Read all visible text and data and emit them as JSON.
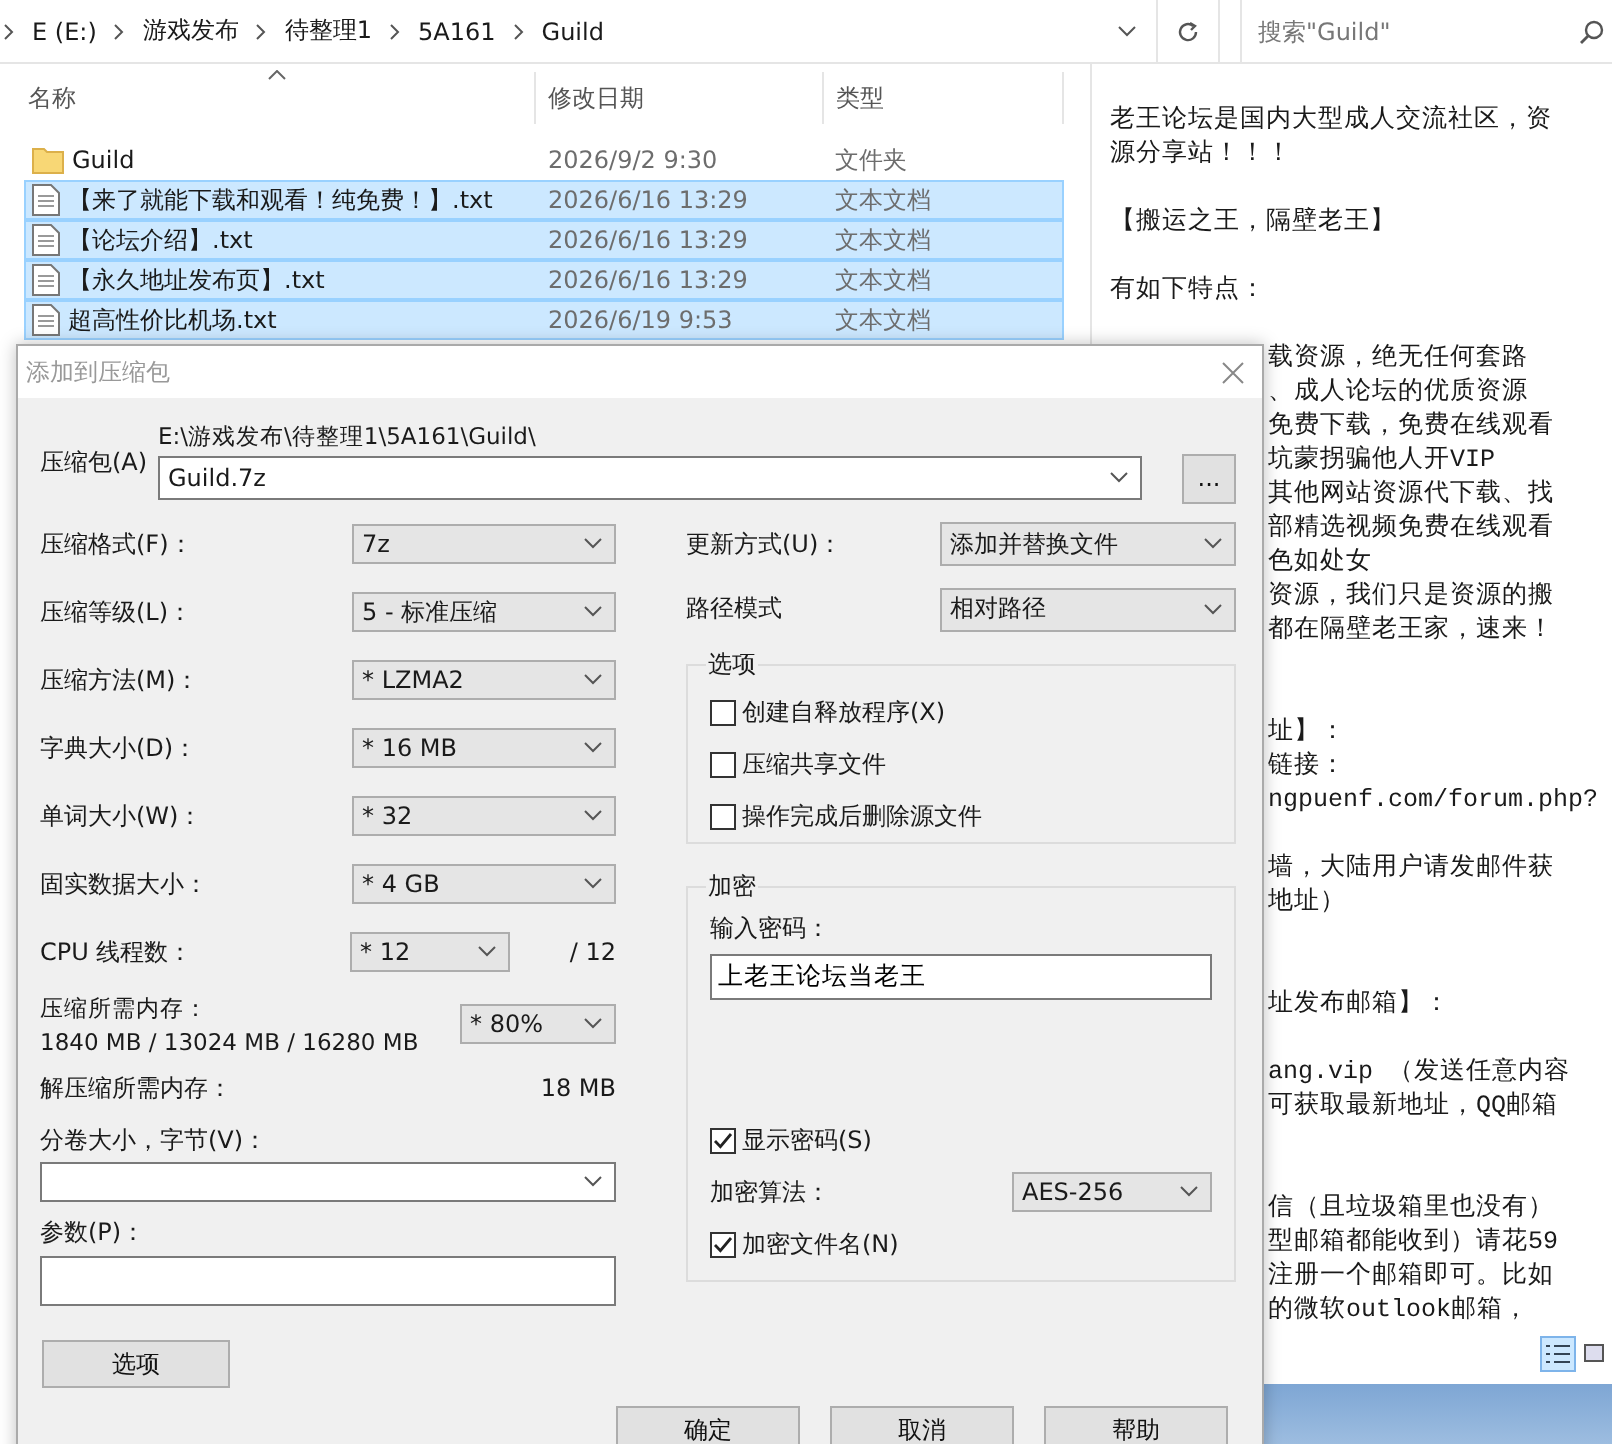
{
  "explorer": {
    "breadcrumb": [
      "E (E:)",
      "游戏发布",
      "待整理1",
      "5A161",
      "Guild"
    ],
    "search": {
      "placeholder": "搜索\"Guild\""
    },
    "columns": [
      "名称",
      "修改日期",
      "类型"
    ],
    "files": [
      {
        "name": "Guild",
        "modified": "2026/9/2 9:30",
        "type": "文件夹",
        "kind": "folder",
        "selected": false
      },
      {
        "name": "【来了就能下载和观看！纯免费！】.txt",
        "modified": "2026/6/16 13:29",
        "type": "文本文档",
        "kind": "text",
        "selected": true
      },
      {
        "name": "【论坛介绍】.txt",
        "modified": "2026/6/16 13:29",
        "type": "文本文档",
        "kind": "text",
        "selected": true
      },
      {
        "name": "【永久地址发布页】.txt",
        "modified": "2026/6/16 13:29",
        "type": "文本文档",
        "kind": "text",
        "selected": true
      },
      {
        "name": "超高性价比机场.txt",
        "modified": "2026/6/19 9:53",
        "type": "文本文档",
        "kind": "text",
        "selected": true
      }
    ]
  },
  "preview": {
    "lines": [
      {
        "kind": "text",
        "text": "老王论坛是国内大型成人交流社区，资"
      },
      {
        "kind": "text",
        "text": "源分享站！！！"
      },
      {
        "kind": "blank"
      },
      {
        "kind": "text",
        "text": "【搬运之王，隔壁老王】"
      },
      {
        "kind": "blank"
      },
      {
        "kind": "text",
        "text": "有如下特点："
      },
      {
        "kind": "blank"
      },
      {
        "kind": "clipped",
        "text": "载资源，绝无任何套路"
      },
      {
        "kind": "clipped",
        "text": "、成人论坛的优质资源"
      },
      {
        "kind": "clipped",
        "text": "免费下载，免费在线观看"
      },
      {
        "kind": "clipped",
        "text": "坑蒙拐骗他人开VIP"
      },
      {
        "kind": "clipped",
        "text": "其他网站资源代下载、找"
      },
      {
        "kind": "clipped",
        "text": "部精选视频免费在线观看"
      },
      {
        "kind": "clipped",
        "text": "色如处女"
      },
      {
        "kind": "clipped",
        "text": "资源，我们只是资源的搬"
      },
      {
        "kind": "clipped",
        "text": "都在隔壁老王家，速来！"
      },
      {
        "kind": "blank"
      },
      {
        "kind": "blank"
      },
      {
        "kind": "clipped",
        "text": "址】："
      },
      {
        "kind": "clipped",
        "text": "链接："
      },
      {
        "kind": "clipped",
        "text": "ngpuenf.com/forum.php?"
      },
      {
        "kind": "blank"
      },
      {
        "kind": "clipped",
        "text": "墙，大陆用户请发邮件获"
      },
      {
        "kind": "clipped",
        "text": "地址）"
      },
      {
        "kind": "blank"
      },
      {
        "kind": "blank"
      },
      {
        "kind": "clipped",
        "text": "址发布邮箱】："
      },
      {
        "kind": "blank"
      },
      {
        "kind": "clipped",
        "text": "ang.vip  （发送任意内容"
      },
      {
        "kind": "clipped",
        "text": "可获取最新地址，QQ邮箱"
      },
      {
        "kind": "blank"
      },
      {
        "kind": "blank"
      },
      {
        "kind": "clipped",
        "text": "信（且垃圾箱里也没有）"
      },
      {
        "kind": "clipped",
        "text": "型邮箱都能收到）请花59"
      },
      {
        "kind": "clipped",
        "text": "注册一个邮箱即可。比如"
      },
      {
        "kind": "clipped",
        "text": "的微软outlook邮箱，"
      }
    ]
  },
  "dialog": {
    "title": "添加到压缩包",
    "archive": {
      "label": "压缩包(A)",
      "path": "E:\\游戏发布\\待整理1\\5A161\\Guild\\",
      "value": "Guild.7z",
      "browse": "..."
    },
    "settings": [
      {
        "label": "压缩格式(F)：",
        "value": "7z"
      },
      {
        "label": "压缩等级(L)：",
        "value": "5 - 标准压缩"
      },
      {
        "label": "压缩方法(M)：",
        "value": "* LZMA2"
      },
      {
        "label": "字典大小(D)：",
        "value": "* 16 MB"
      },
      {
        "label": "单词大小(W)：",
        "value": "* 32"
      },
      {
        "label": "固实数据大小：",
        "value": "* 4 GB"
      }
    ],
    "cpu_threads": {
      "label": "CPU 线程数：",
      "value": "* 12",
      "max": "/ 12"
    },
    "memory": {
      "label": "压缩所需内存：",
      "usage": "1840 MB / 13024 MB / 16280 MB",
      "value": "* 80%"
    },
    "decompress_memory": {
      "label": "解压缩所需内存：",
      "value": "18 MB"
    },
    "volume": {
      "label": "分卷大小，字节(V)："
    },
    "parameters": {
      "label": "参数(P)："
    },
    "options_button": "选项",
    "update_mode": {
      "label": "更新方式(U)：",
      "value": "添加并替换文件"
    },
    "path_mode": {
      "label": "路径模式",
      "value": "相对路径"
    },
    "options": {
      "title": "选项",
      "items": [
        {
          "label": "创建自释放程序(X)",
          "checked": false
        },
        {
          "label": "压缩共享文件",
          "checked": false
        },
        {
          "label": "操作完成后删除源文件",
          "checked": false
        }
      ]
    },
    "encryption": {
      "title": "加密",
      "password_label": "输入密码：",
      "password": "上老王论坛当老王",
      "show_password": {
        "label": "显示密码(S)",
        "checked": true
      },
      "method_label": "加密算法：",
      "method": "AES-256",
      "encrypt_names": {
        "label": "加密文件名(N)",
        "checked": true
      }
    },
    "buttons": [
      "确定",
      "取消",
      "帮助"
    ]
  }
}
